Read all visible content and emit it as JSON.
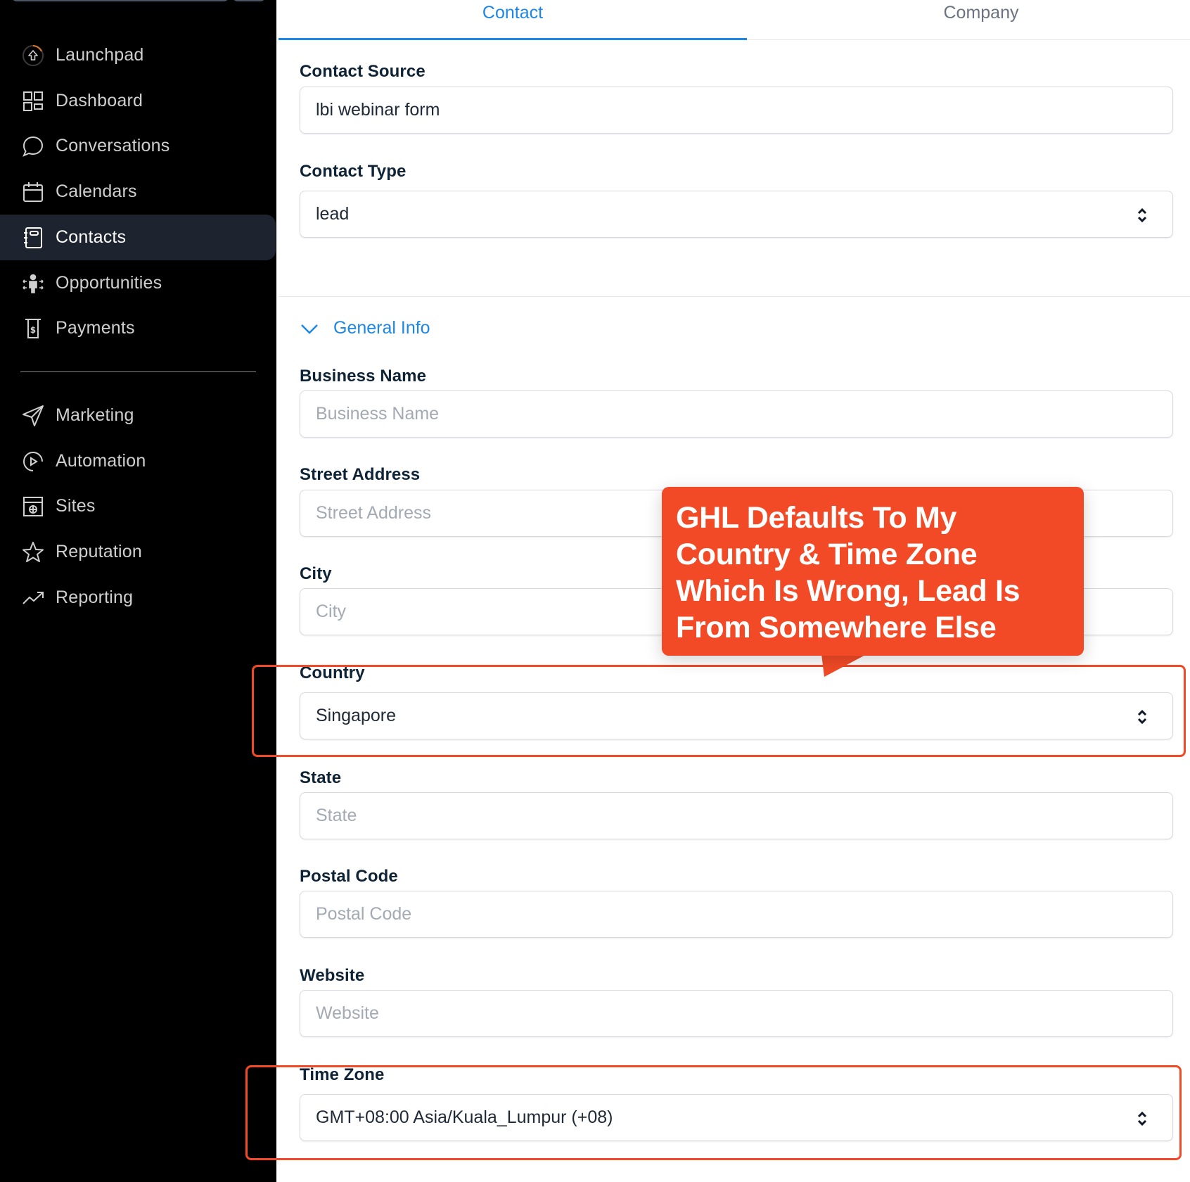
{
  "sidebar": {
    "items": [
      {
        "label": "Launchpad",
        "icon": "launchpad-icon",
        "active": false
      },
      {
        "label": "Dashboard",
        "icon": "dashboard-icon",
        "active": false
      },
      {
        "label": "Conversations",
        "icon": "chat-bubble-icon",
        "active": false
      },
      {
        "label": "Calendars",
        "icon": "calendar-icon",
        "active": false
      },
      {
        "label": "Contacts",
        "icon": "contacts-book-icon",
        "active": true
      },
      {
        "label": "Opportunities",
        "icon": "opportunities-icon",
        "active": false
      },
      {
        "label": "Payments",
        "icon": "payments-icon",
        "active": false
      },
      {
        "label": "Marketing",
        "icon": "paper-plane-icon",
        "active": false
      },
      {
        "label": "Automation",
        "icon": "automation-play-icon",
        "active": false
      },
      {
        "label": "Sites",
        "icon": "sites-globe-icon",
        "active": false
      },
      {
        "label": "Reputation",
        "icon": "star-icon",
        "active": false
      },
      {
        "label": "Reporting",
        "icon": "trend-up-icon",
        "active": false
      }
    ]
  },
  "tabs": [
    {
      "label": "Contact",
      "active": true
    },
    {
      "label": "Company",
      "active": false
    }
  ],
  "form": {
    "contact_source": {
      "label": "Contact Source",
      "value": "lbi webinar form"
    },
    "contact_type": {
      "label": "Contact Type",
      "value": "lead"
    },
    "section_title": "General Info",
    "business_name": {
      "label": "Business Name",
      "placeholder": "Business Name"
    },
    "street_address": {
      "label": "Street Address",
      "placeholder": "Street Address"
    },
    "city": {
      "label": "City",
      "placeholder": "City"
    },
    "country": {
      "label": "Country",
      "value": "Singapore"
    },
    "state": {
      "label": "State",
      "placeholder": "State"
    },
    "postal_code": {
      "label": "Postal Code",
      "placeholder": "Postal Code"
    },
    "website": {
      "label": "Website",
      "placeholder": "Website"
    },
    "time_zone": {
      "label": "Time Zone",
      "value": "GMT+08:00 Asia/Kuala_Lumpur (+08)"
    }
  },
  "annotation": {
    "callout_text": "GHL Defaults To My Country & Time Zone Which Is Wrong, Lead Is From Somewhere Else",
    "color": "#f24a26"
  },
  "colors": {
    "accent": "#1d87e5",
    "sidebar_bg": "#000000",
    "sidebar_active_bg": "#1e2330"
  }
}
